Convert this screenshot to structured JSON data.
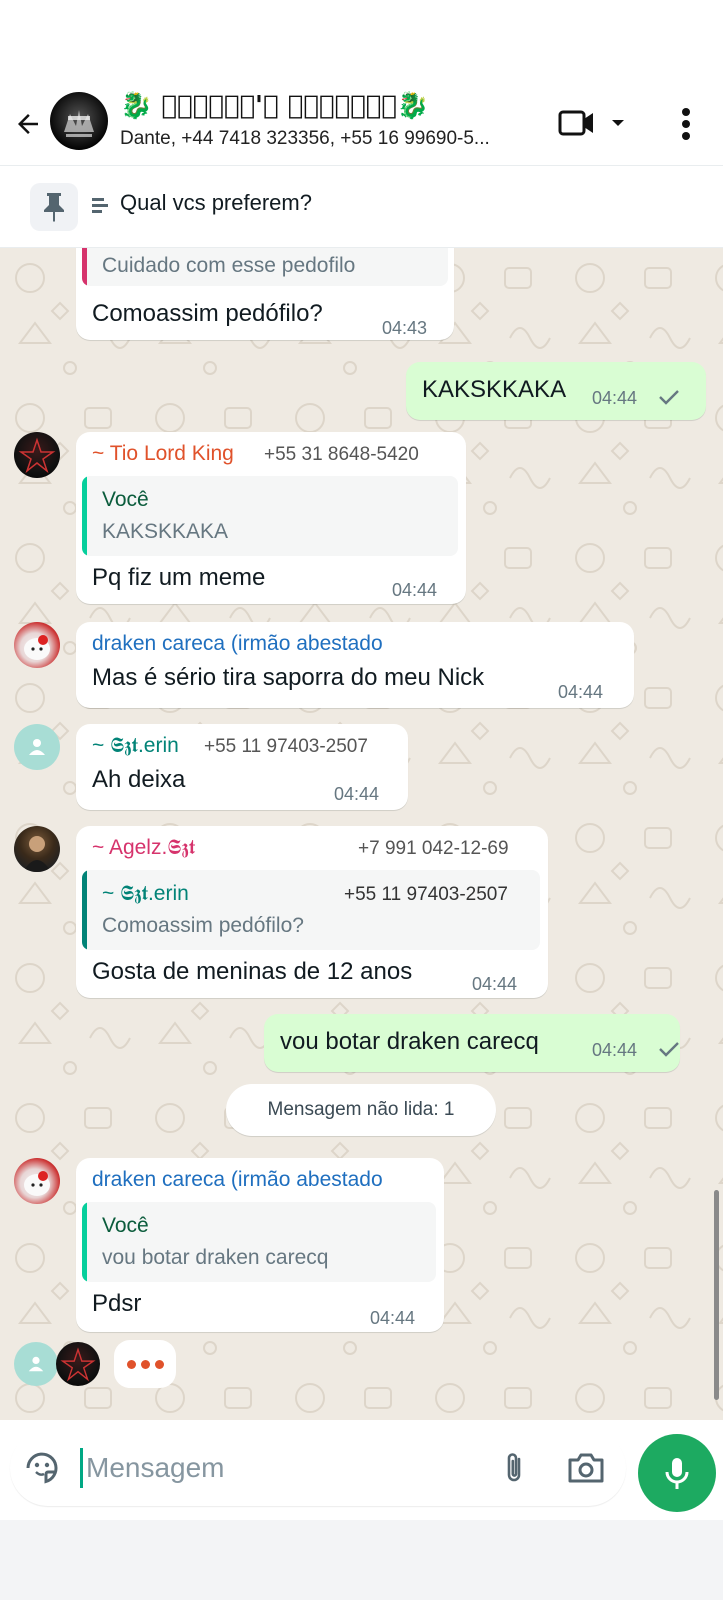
{
  "header": {
    "title": "🐉 ⃤✡𝕾𝖔𝖑𝖙'𝖟 𝕲𝖗𝖔𝖚✡𝖕⃤🐉",
    "subtitle": "Dante, +44 7418 323356, +55 16 99690-5...",
    "icons": [
      "back-arrow-icon",
      "video-call-icon",
      "dropdown-icon",
      "more-vert-icon"
    ]
  },
  "pinned": {
    "text": "Qual vcs preferem?",
    "icon": "pin-icon"
  },
  "messages": [
    {
      "quote_text": "Cuidado com esse pedofilo",
      "text": "Comoassim pedófilo?",
      "time": "04:43"
    },
    {
      "direction": "out",
      "text": "KAKSKKAKA",
      "time": "04:44",
      "status": "sent"
    },
    {
      "sender": "~ Tio Lord King",
      "phone": "+55 31 8648-5420",
      "sender_color": "#e0522b",
      "quote_author": "Você",
      "quote_text": "KAKSKKAKA",
      "text": "Pq fiz um meme",
      "time": "04:44"
    },
    {
      "sender": "draken careca (irmão abestado",
      "sender_color": "#1f6fbf",
      "text": "Mas é sério tira saporra do meu Nick",
      "time": "04:44"
    },
    {
      "sender": "~ 𝕾𝖟𝖙.erin",
      "phone": "+55 11 97403-2507",
      "sender_color": "#028377",
      "text": "Ah deixa",
      "time": "04:44"
    },
    {
      "sender": "~ Agelz.𝕾𝖟𝖙",
      "phone": "+7 991 042-12-69",
      "sender_color": "#d6336c",
      "quote_author": "~ 𝕾𝖟𝖙.erin",
      "quote_phone": "+55 11 97403-2507",
      "quote_text": "Comoassim pedófilo?",
      "text": "Gosta de meninas de 12 anos",
      "time": "04:44"
    },
    {
      "direction": "out",
      "text": "vou botar draken carecq",
      "time": "04:44",
      "status": "sent"
    },
    {
      "sender": "draken careca (irmão abestado",
      "sender_color": "#1f6fbf",
      "quote_author": "Você",
      "quote_text": "vou botar draken carecq",
      "text": "Pdsr",
      "time": "04:44"
    }
  ],
  "unread_label": "Mensagem não lida: 1",
  "composer": {
    "placeholder": "Mensagem",
    "icons": [
      "sticker-icon",
      "attach-icon",
      "camera-icon",
      "mic-icon"
    ]
  },
  "colors": {
    "accent": "#1daa61",
    "outgoing_bubble": "#d9fdd3",
    "chat_background": "#efeae2",
    "quote_self": "#06cf9c",
    "quote_agelz": "#d6336c",
    "quote_erin": "#028377"
  }
}
